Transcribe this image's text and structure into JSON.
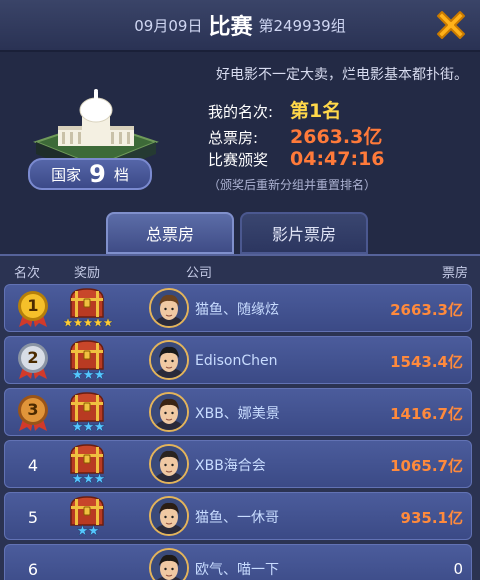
{
  "header": {
    "date": "09月09日",
    "title": "比赛",
    "group": "第249939组"
  },
  "info": {
    "slogan": "好电影不一定大卖，烂电影基本都扑街。",
    "country_prefix": "国家",
    "country_level": "9",
    "country_suffix": "档",
    "rank_label": "我的名次:",
    "rank_value": "第1名",
    "box_label": "总票房:",
    "box_value": "2663.3亿",
    "award_label": "比赛颁奖",
    "award_value": "04:47:16",
    "note": "（颁奖后重新分组并重置排名）"
  },
  "tabs": {
    "total": "总票房",
    "movie": "影片票房"
  },
  "columns": {
    "rank": "名次",
    "reward": "奖励",
    "company": "公司",
    "box_office": "票房"
  },
  "rows": [
    {
      "rank": "1",
      "company": "猫鱼、随缘炫",
      "box": "2663.3亿",
      "stars": 5,
      "star_color": "#ffcc33",
      "medal": "gold"
    },
    {
      "rank": "2",
      "company": "EdisonChen",
      "box": "1543.4亿",
      "stars": 3,
      "star_color": "#55c7ff",
      "medal": "silver"
    },
    {
      "rank": "3",
      "company": "XBB、娜美景",
      "box": "1416.7亿",
      "stars": 3,
      "star_color": "#55c7ff",
      "medal": "bronze"
    },
    {
      "rank": "4",
      "company": "XBB海合会",
      "box": "1065.7亿",
      "stars": 3,
      "star_color": "#55c7ff",
      "medal": "none"
    },
    {
      "rank": "5",
      "company": "猫鱼、一休哥",
      "box": "935.1亿",
      "stars": 2,
      "star_color": "#55c7ff",
      "medal": "none"
    },
    {
      "rank": "6",
      "company": "欧气、喵一下",
      "box": "0",
      "stars": 0,
      "star_color": "#55c7ff",
      "medal": "none"
    }
  ]
}
